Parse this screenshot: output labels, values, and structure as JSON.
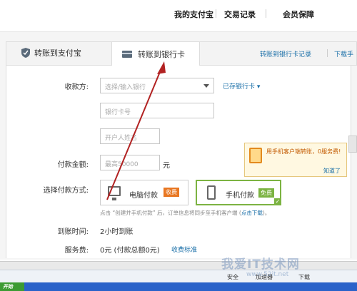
{
  "topnav": {
    "items": [
      "我的支付宝",
      "交易记录",
      "会员保障"
    ]
  },
  "tabs": {
    "tab1": "转账到支付宝",
    "tab2": "转账到银行卡"
  },
  "toplinks": {
    "records": "转账到银行卡记录",
    "download": "下载手"
  },
  "form": {
    "payee_label": "收款方:",
    "bank_placeholder": "选择/输入银行",
    "saved_cards": "已存银行卡 ▾",
    "card_placeholder": "银行卡号",
    "name_placeholder": "开户人姓名",
    "amount_label": "付款金额:",
    "amount_placeholder": "最高50000",
    "amount_unit": "元",
    "method_label": "选择付款方式:",
    "method_pc": "电脑付款",
    "method_pc_badge": "收费",
    "method_mobile": "手机付款",
    "method_mobile_badge": "免费",
    "hint_pre": "点击 “创建并手机付款” 后，订单信息将同步至手机客户端 (",
    "hint_link": "点击下载",
    "hint_post": ")。",
    "arrival_label": "到账时间:",
    "arrival_value": "2小时到账",
    "fee_label": "服务费:",
    "fee_value": "0元 (付款总额0元)",
    "fee_link": "收费标准"
  },
  "tip": {
    "text": "用手机客户端转账，0服务费!",
    "ok": "知道了"
  },
  "statusbar": {
    "safety": "安全",
    "speed": "加速器",
    "download": "下载"
  },
  "taskbar": {
    "start": "开始"
  },
  "watermark": {
    "main": "我爱IT技术网",
    "sub": "www.52it.net"
  },
  "colors": {
    "link": "#1a6fa8",
    "accent_green": "#7cb342",
    "fee_orange": "#e87722",
    "arrow": "#b22222"
  }
}
